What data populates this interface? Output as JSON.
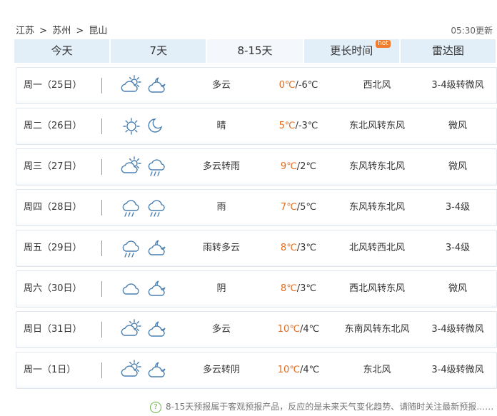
{
  "breadcrumb": {
    "province": "江苏",
    "sep": ">",
    "city": "苏州",
    "district": "昆山"
  },
  "update_time": "05:30更新",
  "tabs": [
    {
      "label": "今天"
    },
    {
      "label": "7天"
    },
    {
      "label": "8-15天",
      "active": true
    },
    {
      "label": "更长时间",
      "badge": "hot"
    },
    {
      "label": "雷达图"
    }
  ],
  "days": [
    {
      "date": "周一（25日）",
      "icon1": "partly-cloudy-day-icon",
      "icon2": "partly-cloudy-night-icon",
      "desc": "多云",
      "high": "0℃",
      "low": "/-6℃",
      "wind": "西北风",
      "level": "3-4级转微风"
    },
    {
      "date": "周二（26日）",
      "icon1": "sunny-icon",
      "icon2": "moon-icon",
      "desc": "晴",
      "high": "5℃",
      "low": "/-3℃",
      "wind": "东北风转东风",
      "level": "微风"
    },
    {
      "date": "周三（27日）",
      "icon1": "partly-cloudy-day-icon",
      "icon2": "rain-icon",
      "desc": "多云转雨",
      "high": "9℃",
      "low": "/2℃",
      "wind": "东风转东北风",
      "level": "微风"
    },
    {
      "date": "周四（28日）",
      "icon1": "rain-icon",
      "icon2": "rain-icon",
      "desc": "雨",
      "high": "7℃",
      "low": "/5℃",
      "wind": "东风转东北风",
      "level": "3-4级"
    },
    {
      "date": "周五（29日）",
      "icon1": "rain-icon",
      "icon2": "partly-cloudy-night-icon",
      "desc": "雨转多云",
      "high": "8℃",
      "low": "/3℃",
      "wind": "北风转西北风",
      "level": "3-4级"
    },
    {
      "date": "周六（30日）",
      "icon1": "cloudy-icon",
      "icon2": "partly-cloudy-night-icon",
      "desc": "阴",
      "high": "8℃",
      "low": "/3℃",
      "wind": "西北风转东风",
      "level": "微风"
    },
    {
      "date": "周日（31日）",
      "icon1": "partly-cloudy-day-icon",
      "icon2": "partly-cloudy-night-icon",
      "desc": "多云",
      "high": "10℃",
      "low": "/4℃",
      "wind": "东南风转东北风",
      "level": "3-4级转微风"
    },
    {
      "date": "周一（1日）",
      "icon1": "partly-cloudy-day-icon",
      "icon2": "partly-cloudy-night-icon",
      "desc": "多云转阴",
      "high": "10℃",
      "low": "/4℃",
      "wind": "东北风",
      "level": "3-4级转微风"
    }
  ],
  "footer_note": "8-15天预报属于客观预报产品，反应的是未来天气变化趋势、请随时关注最新预报……",
  "colors": {
    "accent": "#e46b1c",
    "tab_bg": "#e2eef8",
    "icon": "#4a7fb0"
  }
}
